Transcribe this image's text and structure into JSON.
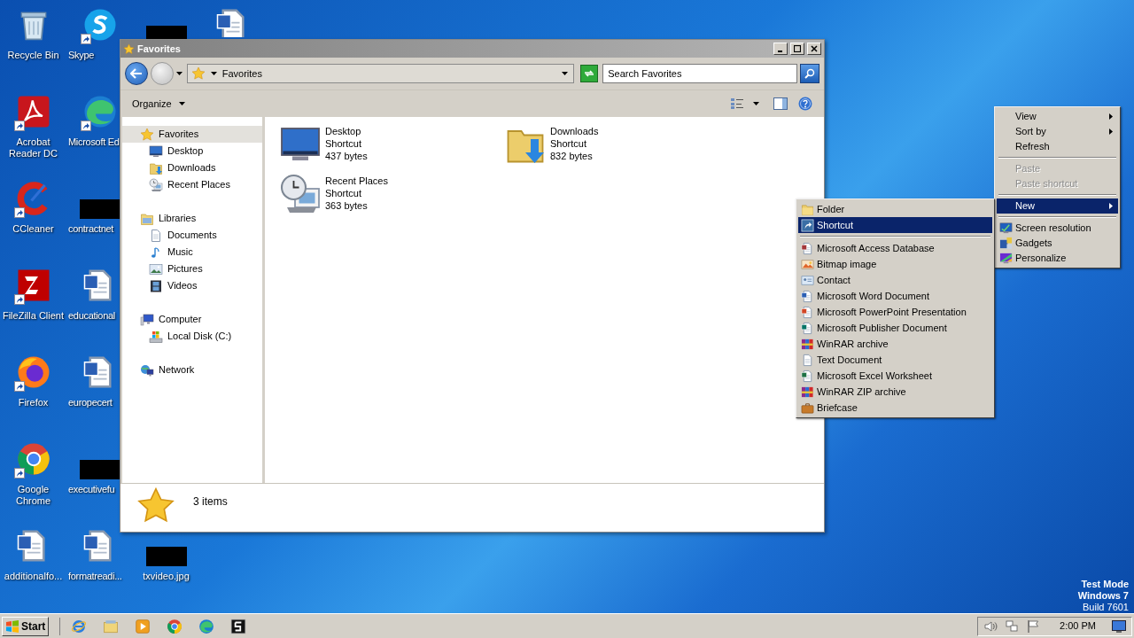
{
  "desktop": {
    "columns": [
      [
        {
          "label": "Recycle Bin",
          "kind": "recycle",
          "shortcut": false
        },
        {
          "label": "Acrobat Reader DC",
          "kind": "acrobat",
          "shortcut": true
        },
        {
          "label": "CCleaner",
          "kind": "ccleaner",
          "shortcut": true
        },
        {
          "label": "FileZilla Client",
          "kind": "filezilla",
          "shortcut": true
        },
        {
          "label": "Firefox",
          "kind": "firefox",
          "shortcut": true
        },
        {
          "label": "Google Chrome",
          "kind": "chrome",
          "shortcut": true
        },
        {
          "label": "additionalfo...",
          "kind": "word",
          "shortcut": false
        }
      ],
      [
        {
          "label": "Skype",
          "kind": "skype",
          "shortcut": true
        },
        {
          "label": "Microsoft Ed",
          "kind": "edge",
          "shortcut": true
        },
        {
          "label": "contractnet",
          "kind": "redacted",
          "shortcut": false
        },
        {
          "label": "educational",
          "kind": "word",
          "shortcut": false
        },
        {
          "label": "europecert",
          "kind": "word",
          "shortcut": false
        },
        {
          "label": "executivefu",
          "kind": "redacted",
          "shortcut": false
        },
        {
          "label": "formatreadi...",
          "kind": "word",
          "shortcut": false
        }
      ],
      [
        {
          "kind": "redacted",
          "shortcut": false
        },
        {
          "label": "txvideo.jpg",
          "kind": "redacted",
          "shortcut": false
        }
      ],
      [
        {
          "kind": "word",
          "shortcut": false
        }
      ]
    ],
    "os_notice": [
      "Test Mode",
      "Windows 7",
      "Build 7601"
    ]
  },
  "window": {
    "title": "Favorites",
    "address": "Favorites",
    "search": {
      "placeholder": "Search Favorites"
    },
    "organize": "Organize",
    "nav": [
      {
        "label": "Favorites",
        "kind": "star",
        "selected": true,
        "children": [
          {
            "label": "Desktop",
            "kind": "desktop",
            "selected": false
          },
          {
            "label": "Downloads",
            "kind": "downloads",
            "selected": false
          },
          {
            "label": "Recent Places",
            "kind": "recent",
            "selected": false
          }
        ]
      },
      {
        "label": "Libraries",
        "kind": "library",
        "selected": false,
        "children": [
          {
            "label": "Documents",
            "kind": "documents",
            "selected": false
          },
          {
            "label": "Music",
            "kind": "music",
            "selected": false
          },
          {
            "label": "Pictures",
            "kind": "pictures",
            "selected": false
          },
          {
            "label": "Videos",
            "kind": "videos",
            "selected": false
          }
        ]
      },
      {
        "label": "Computer",
        "kind": "computer",
        "selected": false,
        "children": [
          {
            "label": "Local Disk (C:)",
            "kind": "disk",
            "selected": false
          }
        ]
      },
      {
        "label": "Network",
        "kind": "network",
        "selected": false
      }
    ],
    "items": [
      {
        "name": "Desktop",
        "type": "Shortcut",
        "size": "437 bytes",
        "kind": "desktop"
      },
      {
        "name": "Downloads",
        "type": "Shortcut",
        "size": "832 bytes",
        "kind": "downloads"
      },
      {
        "name": "Recent Places",
        "type": "Shortcut",
        "size": "363 bytes",
        "kind": "recent"
      }
    ],
    "status": "3 items"
  },
  "context_menu": {
    "items": [
      {
        "kind": "plain",
        "label": "View",
        "submenu": true,
        "disabled": false,
        "selected": false
      },
      {
        "kind": "plain",
        "label": "Sort by",
        "submenu": true,
        "disabled": false,
        "selected": false
      },
      {
        "kind": "plain",
        "label": "Refresh",
        "submenu": false,
        "disabled": false,
        "selected": false
      },
      {
        "kind": "separator"
      },
      {
        "kind": "plain",
        "label": "Paste",
        "submenu": false,
        "disabled": true,
        "selected": false
      },
      {
        "kind": "plain",
        "label": "Paste shortcut",
        "submenu": false,
        "disabled": true,
        "selected": false
      },
      {
        "kind": "separator"
      },
      {
        "kind": "plain",
        "label": "New",
        "submenu": true,
        "disabled": false,
        "selected": true
      },
      {
        "kind": "separator"
      },
      {
        "kind": "screenres",
        "label": "Screen resolution",
        "submenu": false,
        "disabled": false,
        "selected": false
      },
      {
        "kind": "gadgets",
        "label": "Gadgets",
        "submenu": false,
        "disabled": false,
        "selected": false
      },
      {
        "kind": "personalize",
        "label": "Personalize",
        "submenu": false,
        "disabled": false,
        "selected": false
      }
    ]
  },
  "new_submenu": {
    "items": [
      {
        "kind": "folder",
        "label": "Folder",
        "selected": false
      },
      {
        "kind": "shortcut",
        "label": "Shortcut",
        "selected": true
      },
      {
        "kind": "separator"
      },
      {
        "kind": "access",
        "label": "Microsoft Access Database",
        "selected": false
      },
      {
        "kind": "bitmap",
        "label": "Bitmap image",
        "selected": false
      },
      {
        "kind": "contact",
        "label": "Contact",
        "selected": false
      },
      {
        "kind": "word",
        "label": "Microsoft Word Document",
        "selected": false
      },
      {
        "kind": "powerpoint",
        "label": "Microsoft PowerPoint Presentation",
        "selected": false
      },
      {
        "kind": "publisher",
        "label": "Microsoft Publisher Document",
        "selected": false
      },
      {
        "kind": "winrar",
        "label": "WinRAR archive",
        "selected": false
      },
      {
        "kind": "text",
        "label": "Text Document",
        "selected": false
      },
      {
        "kind": "excel",
        "label": "Microsoft Excel Worksheet",
        "selected": false
      },
      {
        "kind": "winrar",
        "label": "WinRAR ZIP archive",
        "selected": false
      },
      {
        "kind": "briefcase",
        "label": "Briefcase",
        "selected": false
      }
    ]
  },
  "taskbar": {
    "start": "Start",
    "apps": [
      {
        "kind": "ie"
      },
      {
        "kind": "explorer"
      },
      {
        "kind": "mediaplayer"
      },
      {
        "kind": "chrome"
      },
      {
        "kind": "edge"
      },
      {
        "kind": "app5"
      }
    ],
    "clock": "2:00 PM"
  }
}
